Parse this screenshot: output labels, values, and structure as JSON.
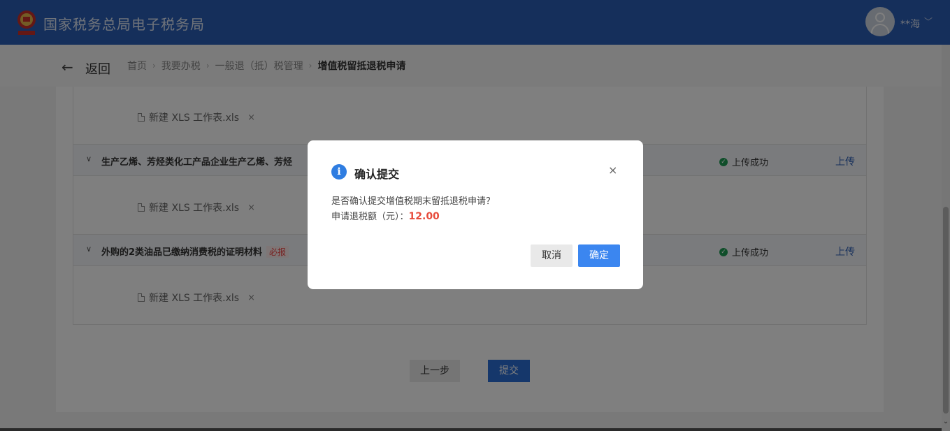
{
  "header": {
    "title": "国家税务总局电子税务局",
    "username": "**海"
  },
  "breadcrumb": {
    "back_label": "返回",
    "items": [
      "首页",
      "我要办税",
      "一般退（抵）税管理",
      "增值税留抵退税申请"
    ]
  },
  "rows": [
    {
      "title": "",
      "file": "新建 XLS 工作表.xls"
    },
    {
      "title": "生产乙烯、芳烃类化工产品企业生产乙烯、芳烃",
      "badge": "",
      "status": "上传成功",
      "action": "上传",
      "file": "新建 XLS 工作表.xls"
    },
    {
      "title": "外购的2类油品已缴纳消费税的证明材料",
      "badge": "必报",
      "status": "上传成功",
      "action": "上传",
      "file": "新建 XLS 工作表.xls"
    }
  ],
  "buttons": {
    "prev": "上一步",
    "submit": "提交"
  },
  "dialog": {
    "title": "确认提交",
    "message": "是否确认提交增值税期末留抵退税申请？",
    "amount_label": "申请退税额（元）：",
    "amount_value": "12.00",
    "cancel": "取消",
    "ok": "确定",
    "close": "×"
  },
  "colors": {
    "header_bg": "#2b5fb7",
    "primary": "#3b86f0",
    "amount": "#e74c3c",
    "success": "#1f9d55"
  },
  "icons": {
    "back": "arrow-left-icon",
    "info": "info-icon",
    "file": "file-icon",
    "close": "close-icon"
  }
}
